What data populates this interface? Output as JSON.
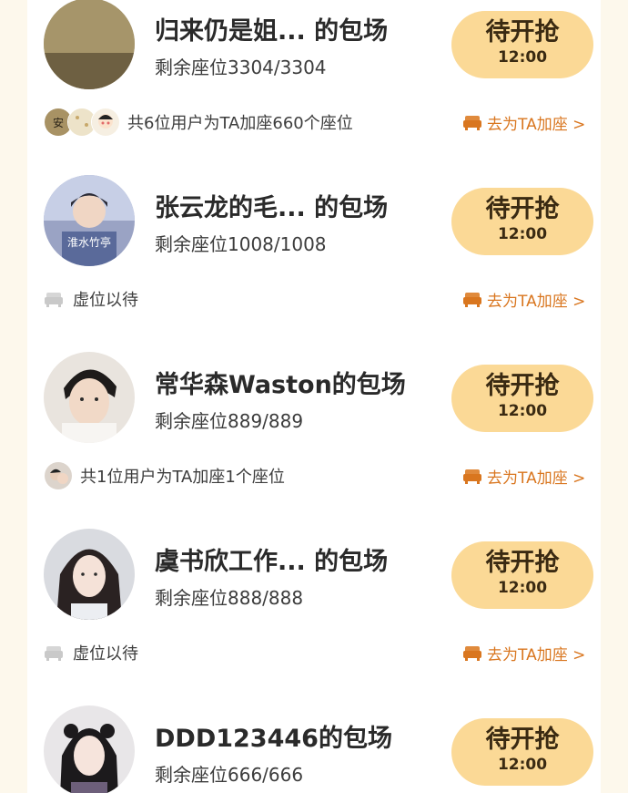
{
  "sessions": [
    {
      "title": "归来仍是姐...  的包场",
      "seats": "剩余座位3304/3304",
      "button": {
        "label": "待开抢",
        "time": "12:00"
      },
      "support": {
        "type": "users",
        "text": "共6位用户为TA加座660个座位"
      },
      "add_label": "去为TA加座 >",
      "avatar_text": "安心"
    },
    {
      "title": "张云龙的毛...  的包场",
      "seats": "剩余座位1008/1008",
      "button": {
        "label": "待开抢",
        "time": "12:00"
      },
      "support": {
        "type": "empty",
        "text": "虚位以待"
      },
      "add_label": "去为TA加座 >",
      "avatar_text": "淮水竹亭"
    },
    {
      "title": "常华森Waston的包场",
      "seats": "剩余座位889/889",
      "button": {
        "label": "待开抢",
        "time": "12:00"
      },
      "support": {
        "type": "users",
        "text": "共1位用户为TA加座1个座位"
      },
      "add_label": "去为TA加座 >"
    },
    {
      "title": "虞书欣工作...  的包场",
      "seats": "剩余座位888/888",
      "button": {
        "label": "待开抢",
        "time": "12:00"
      },
      "support": {
        "type": "empty",
        "text": "虚位以待"
      },
      "add_label": "去为TA加座 >"
    },
    {
      "title": "DDD123446的包场",
      "seats": "剩余座位666/666",
      "button": {
        "label": "待开抢",
        "time": "12:00"
      }
    }
  ],
  "colors": {
    "page_bg": "#fdf8ec",
    "button_bg": "#fbd996",
    "link": "#d9761f"
  }
}
